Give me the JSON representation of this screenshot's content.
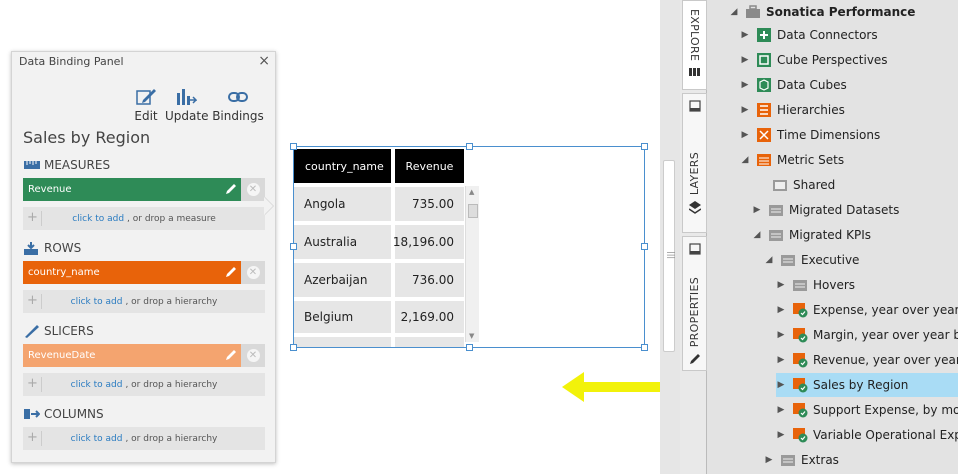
{
  "panel": {
    "title": "Data Binding Panel",
    "close_glyph": "×",
    "toolbar": {
      "edit": "Edit",
      "update": "Update",
      "bindings": "Bindings"
    },
    "heading": "Sales by Region",
    "sections": {
      "measures": {
        "label": "MEASURES",
        "item": "Revenue",
        "item_color": "#2e8b57",
        "drop_link": "click to add",
        "drop_text": ", or drop a measure"
      },
      "rows": {
        "label": "ROWS",
        "item": "country_name",
        "item_color": "#e8630a",
        "drop_link": "click to add",
        "drop_text": ", or drop a hierarchy"
      },
      "slicers": {
        "label": "SLICERS",
        "item": "RevenueDate",
        "item_color": "#f4a46f",
        "drop_link": "click to add",
        "drop_text": ", or drop a hierarchy"
      },
      "columns": {
        "label": "COLUMNS",
        "drop_link": "click to add",
        "drop_text": ", or drop a hierarchy"
      }
    }
  },
  "table": {
    "headers": [
      "country_name",
      "Revenue"
    ],
    "rows": [
      {
        "country": "Angola",
        "revenue": "735.00"
      },
      {
        "country": "Australia",
        "revenue": "18,196.00"
      },
      {
        "country": "Azerbaijan",
        "revenue": "736.00"
      },
      {
        "country": "Belgium",
        "revenue": "2,169.00"
      }
    ]
  },
  "tabs": {
    "explore": "EXPLORE",
    "layers": "LAYERS",
    "properties": "PROPERTIES"
  },
  "tree": {
    "root": "Sonatica Performance",
    "items": {
      "data_connectors": "Data Connectors",
      "cube_perspectives": "Cube Perspectives",
      "data_cubes": "Data Cubes",
      "hierarchies": "Hierarchies",
      "time_dimensions": "Time Dimensions",
      "metric_sets": "Metric Sets",
      "shared": "Shared",
      "migrated_datasets": "Migrated Datasets",
      "migrated_kpis": "Migrated KPIs",
      "executive": "Executive",
      "hovers": "Hovers",
      "expense": "Expense, year over year by r",
      "margin": "Margin, year over year by r",
      "revenue": "Revenue, year over year by",
      "sales_by_region": "Sales by Region",
      "support_expense": "Support Expense, by month",
      "variable_opex": "Variable Operational Expens",
      "extras": "Extras"
    }
  },
  "colors": {
    "accent_blue": "#4a8fce",
    "selection": "#a9dcf5",
    "arrow_yellow": "#f2f20a"
  }
}
